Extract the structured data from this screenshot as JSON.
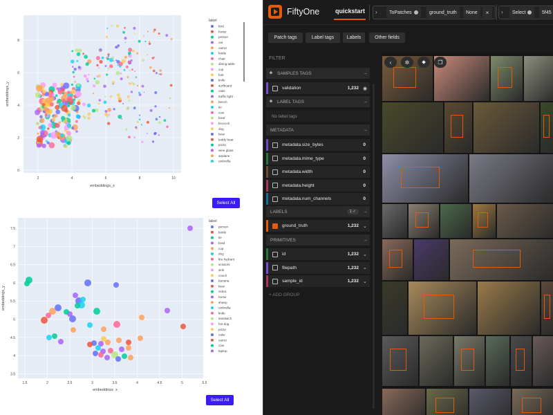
{
  "notebook": {
    "plot1": {
      "xlabel": "embeddings_x",
      "ylabel": "embeddings_y",
      "xticks": [
        "2",
        "4",
        "6",
        "8",
        "10"
      ],
      "yticks": [
        "8",
        "6",
        "4",
        "2",
        "0"
      ],
      "legend_title": "label",
      "legend_items": [
        "bird",
        "horse",
        "person",
        "cat",
        "carrot",
        "bottle",
        "chair",
        "dining table",
        "cup",
        "fork",
        "knife",
        "surfboard",
        "cake",
        "traffic light",
        "bench",
        "tie",
        "cow",
        "bowl",
        "broccoli",
        "dog",
        "bear",
        "teddy bear",
        "pizza",
        "wine glass",
        "airplane",
        "umbrella"
      ],
      "button": "Select All"
    },
    "plot2": {
      "xlabel": "embeddings_x",
      "ylabel": "embeddings_y",
      "xticks": [
        "1.5",
        "2",
        "2.5",
        "3",
        "3.5",
        "4",
        "4.5",
        "5",
        "5.5"
      ],
      "yticks": [
        "7.5",
        "7",
        "6.5",
        "6",
        "5.5",
        "5",
        "4.5",
        "4",
        "3.5"
      ],
      "legend_title": "label",
      "legend_items": [
        "person",
        "bottle",
        "tie",
        "bowl",
        "cup",
        "dog",
        "fire hydrant",
        "scissors",
        "sink",
        "couch",
        "banana",
        "bear",
        "zebra",
        "horse",
        "sheep",
        "umbrella",
        "knife",
        "sandwich",
        "hot dog",
        "pizza",
        "cake",
        "carrot",
        "cow",
        "laptop"
      ],
      "button": "Select All"
    },
    "legend_colors": [
      "#636efa",
      "#ef553b",
      "#00cc96",
      "#ab63fa",
      "#ffa15a",
      "#19d3f3",
      "#ff6692",
      "#b6e880",
      "#ff97ff",
      "#fecb52"
    ]
  },
  "app": {
    "brand": "FiftyOne",
    "dataset": "quickstart",
    "stage1_name": "ToPatches",
    "stage1_arg": "ground_truth",
    "stage2_value": "None",
    "close_symbol": "×",
    "stage3_name": "Select",
    "stage3_value": "5f45",
    "buttons": [
      "Patch tags",
      "Label tags",
      "Labels",
      "Other fields"
    ],
    "filter_title": "FILTER",
    "groups": {
      "samples_tags": "SAMPLES TAGS",
      "label_tags": "LABEL TAGS",
      "metadata": "METADATA",
      "labels": "LABELS",
      "primitives": "PRIMITIVES"
    },
    "samples_tag_field": {
      "label": "validation",
      "count": "1,232"
    },
    "no_label_tags": "No label tags",
    "metadata_fields": [
      {
        "label": "metadata.size_bytes",
        "count": "0"
      },
      {
        "label": "metadata.mime_type",
        "count": "0"
      },
      {
        "label": "metadata.width",
        "count": "0"
      },
      {
        "label": "metadata.height",
        "count": "0"
      },
      {
        "label": "metadata.num_channels",
        "count": "0"
      }
    ],
    "labels_badge": "1 ✓",
    "label_field": {
      "label": "ground_truth",
      "count": "1,232"
    },
    "primitive_fields": [
      {
        "label": "id",
        "count": "1,232"
      },
      {
        "label": "filepath",
        "count": "1,232"
      },
      {
        "label": "sample_id",
        "count": "1,232"
      }
    ],
    "add_group": "+ ADD GROUP",
    "accent": "#e55b0d"
  }
}
